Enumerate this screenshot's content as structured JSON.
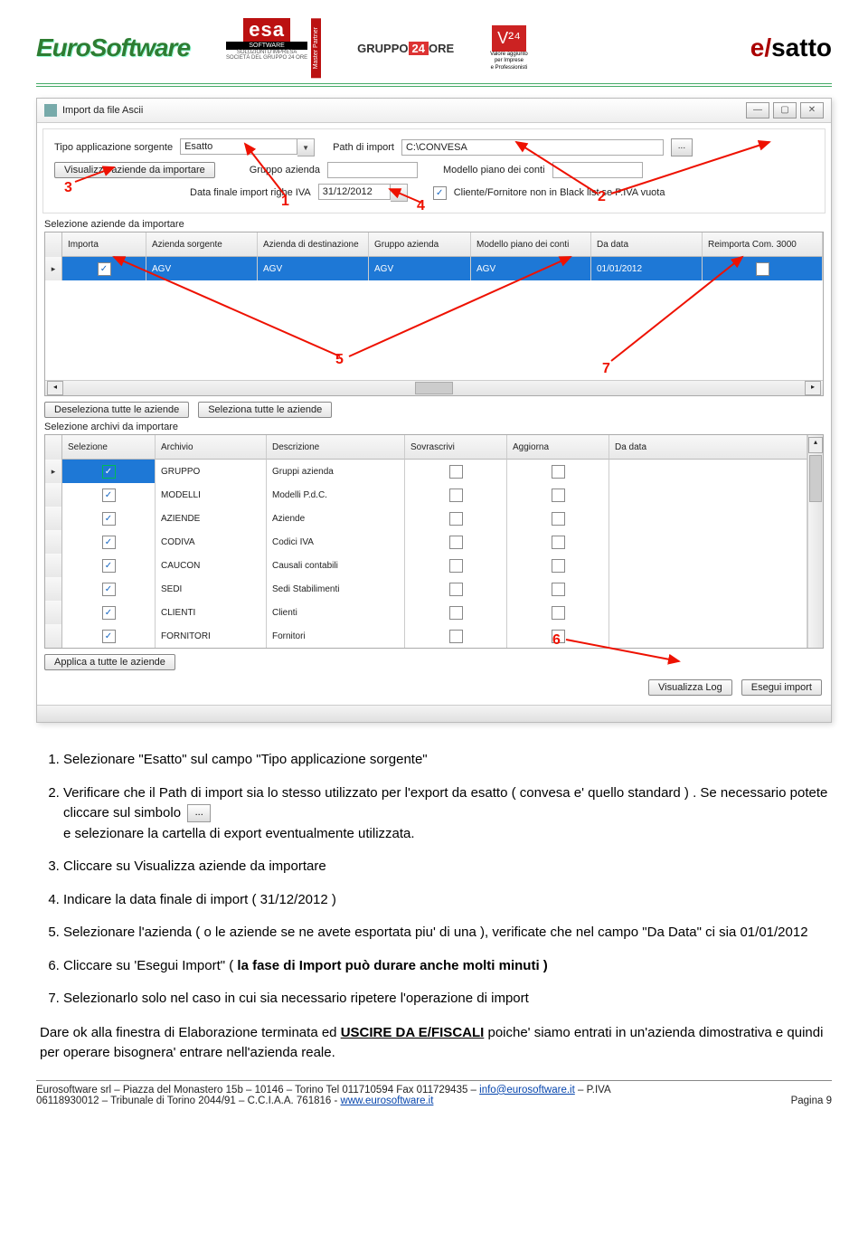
{
  "header": {
    "logo_euro": "EuroSoftware",
    "esa_top": "esa",
    "esa_sw": "SOFTWARE",
    "esa_sol": "SOLUZIONI D'IMPRESA",
    "esa_soc": "SOCIETÀ DEL GRUPPO 24 ORE",
    "esa_partner": "Master Partner",
    "gruppo_pre": "GRUPPO",
    "gruppo_24": "24",
    "gruppo_post": "ORE",
    "v24_box": "V²⁴",
    "v24_line1": "Valore aggiunto",
    "v24_line2": "per Imprese",
    "v24_line3": "e Professionisti",
    "brand_e": "e",
    "brand_slash": "/",
    "brand_rest": "satto"
  },
  "window": {
    "title": "Import da file Ascii",
    "labels": {
      "tipo_app": "Tipo applicazione sorgente",
      "path": "Path di import",
      "btn_visualizza": "Visualizza aziende da importare",
      "gruppo": "Gruppo azienda",
      "modello": "Modello piano dei conti",
      "data_finale": "Data finale import righe IVA",
      "cliente_fornitore": "Cliente/Fornitore non in Black list se P.IVA vuota",
      "sel_aziende": "Selezione aziende da importare",
      "desel_tutte": "Deseleziona tutte le aziende",
      "sel_tutte": "Seleziona tutte le aziende",
      "sel_archivi": "Selezione archivi da importare",
      "applica_tutte": "Applica a tutte le aziende",
      "vis_log": "Visualizza Log",
      "esegui": "Esegui import"
    },
    "values": {
      "tipo_app_value": "Esatto",
      "path_value": "C:\\CONVESA",
      "gruppo_value": "",
      "modello_value": "",
      "data_finale_value": "31/12/2012"
    },
    "grid_az": {
      "headers": [
        "Importa",
        "Azienda sorgente",
        "Azienda di destinazione",
        "Gruppo azienda",
        "Modello piano dei conti",
        "Da data",
        "Reimporta Com. 3000"
      ],
      "row": {
        "importa_checked": "✓",
        "sorgente": "AGV",
        "dest": "AGV",
        "gruppo": "AGV",
        "modello": "AGV",
        "da_data": "01/01/2012"
      }
    },
    "grid_arch": {
      "headers": [
        "Selezione",
        "Archivio",
        "Descrizione",
        "Sovrascrivi",
        "Aggiorna",
        "Da data"
      ],
      "rows": [
        {
          "arch": "GRUPPO",
          "desc": "Gruppi azienda"
        },
        {
          "arch": "MODELLI",
          "desc": "Modelli P.d.C."
        },
        {
          "arch": "AZIENDE",
          "desc": "Aziende"
        },
        {
          "arch": "CODIVA",
          "desc": "Codici IVA"
        },
        {
          "arch": "CAUCON",
          "desc": "Causali contabili"
        },
        {
          "arch": "SEDI",
          "desc": "Sedi Stabilimenti"
        },
        {
          "arch": "CLIENTI",
          "desc": "Clienti"
        },
        {
          "arch": "FORNITORI",
          "desc": "Fornitori"
        }
      ]
    }
  },
  "annotations": {
    "n1": "1",
    "n2": "2",
    "n3": "3",
    "n4": "4",
    "n5": "5",
    "n6": "6",
    "n7": "7"
  },
  "body": {
    "li1_a": "Selezionare \"Esatto\" sul campo \"Tipo applicazione sorgente\"",
    "li2_a": "Verificare che il Path di import sia lo stesso utilizzato per l'export da esatto ( convesa e' quello standard ) . Se necessario potete cliccare sul simbolo",
    "li2_b": "e selezionare la cartella di export eventualmente  utilizzata.",
    "li3": "Cliccare su Visualizza aziende da importare",
    "li4": "Indicare la data finale di import ( 31/12/2012 )",
    "li5": "Selezionare l'azienda ( o le aziende se ne avete esportata piu' di una ), verificate che nel campo \"Da Data\" ci sia 01/01/2012",
    "li6_a": "Cliccare su 'Esegui Import\" ( ",
    "li6_b": "la fase di Import può durare anche molti minuti )",
    "li7": "Selezionarlo solo nel caso in cui sia necessario ripetere l'operazione di import",
    "final_a": "Dare ok alla finestra di Elaborazione terminata ed ",
    "final_u": "USCIRE DA E/FISCALI",
    "final_b": " poiche' siamo entrati in un'azienda dimostrativa e quindi per operare bisognera' entrare nell'azienda reale."
  },
  "footer": {
    "line1_a": "Eurosoftware srl – Piazza del Monastero 15b – 10146 – Torino  Tel 011710594  Fax 011729435 – ",
    "mail": "info@eurosoftware.it",
    "line1_b": " – P.IVA",
    "line2_a": "06118930012 – Tribunale di Torino 2044/91 – C.C.I.A.A. 761816 - ",
    "site": "www.eurosoftware.it",
    "page": "Pagina 9"
  }
}
